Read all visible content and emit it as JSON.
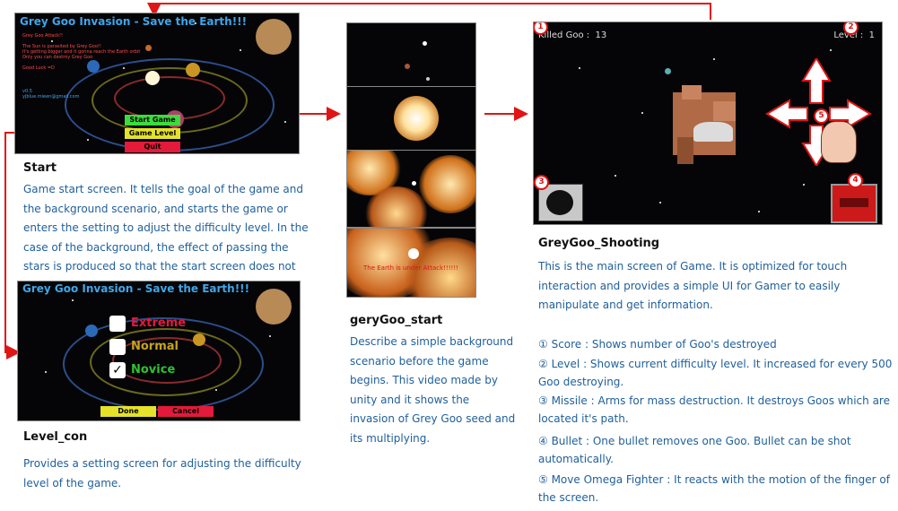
{
  "start": {
    "game_title": "Grey Goo Invasion - Save the Earth!!!",
    "lines": [
      "Grey Goo Attack!!",
      "The Sun is parasited by Grey Goo!!",
      "It's getting bigger and it gonna reach the Earth orbit",
      "Only you can destroy Grey Goo",
      "Good Luck =D"
    ],
    "version": "v0.5",
    "email": "yjblue.mieen@gmail.com",
    "btn_start": "Start Game",
    "btn_level": "Game Level",
    "btn_quit": "Quit",
    "heading": "Start",
    "description": "Game start screen. It tells the goal of the game and the background scenario, and starts the game or enters the setting to adjust the difficulty level. In the case of the background, the effect of passing the stars is produced so that the start screen does not feel bored."
  },
  "level": {
    "game_title": "Grey Goo Invasion - Save the Earth!!!",
    "opt_extreme": "Extreme",
    "opt_normal": "Normal",
    "opt_novice": "Novice",
    "btn_done": "Done",
    "btn_cancel": "Cancel",
    "heading": "Level_con",
    "description": "Provides a setting screen for adjusting the difficulty level of the game."
  },
  "intro": {
    "attack_text": "The Earth is under Attack!!!!!!",
    "heading": "geryGoo_start",
    "description": "Describe a simple background scenario before the game begins. This video made by unity and it shows the invasion of Grey Goo seed and its multiplying."
  },
  "shooting": {
    "killed_label": "Killed Goo :",
    "killed_value": "13",
    "level_label": "Level :",
    "level_value": "1",
    "heading": "GreyGoo_Shooting",
    "description": "This is the main screen of Game. It is optimized for touch interaction and provides a simple UI for Gamer to easily manipulate and get information.",
    "markers": [
      "1",
      "2",
      "3",
      "4",
      "5"
    ],
    "items": [
      "① Score : Shows number of Goo's destroyed",
      "② Level : Shows current difficulty level. It increased for every 500 Goo destroying.",
      "③ Missile : Arms for mass destruction. It destroys Goos which are located it's path.",
      "④ Bullet : One bullet removes one Goo. Bullet can be shot automatically.",
      "⑤ Move Omega Fighter : It reacts with the motion of the finger of the screen."
    ]
  },
  "colors": {
    "arrow": "#e01515",
    "caption": "#1f5f9a",
    "title_blue": "#3fa6e8"
  }
}
